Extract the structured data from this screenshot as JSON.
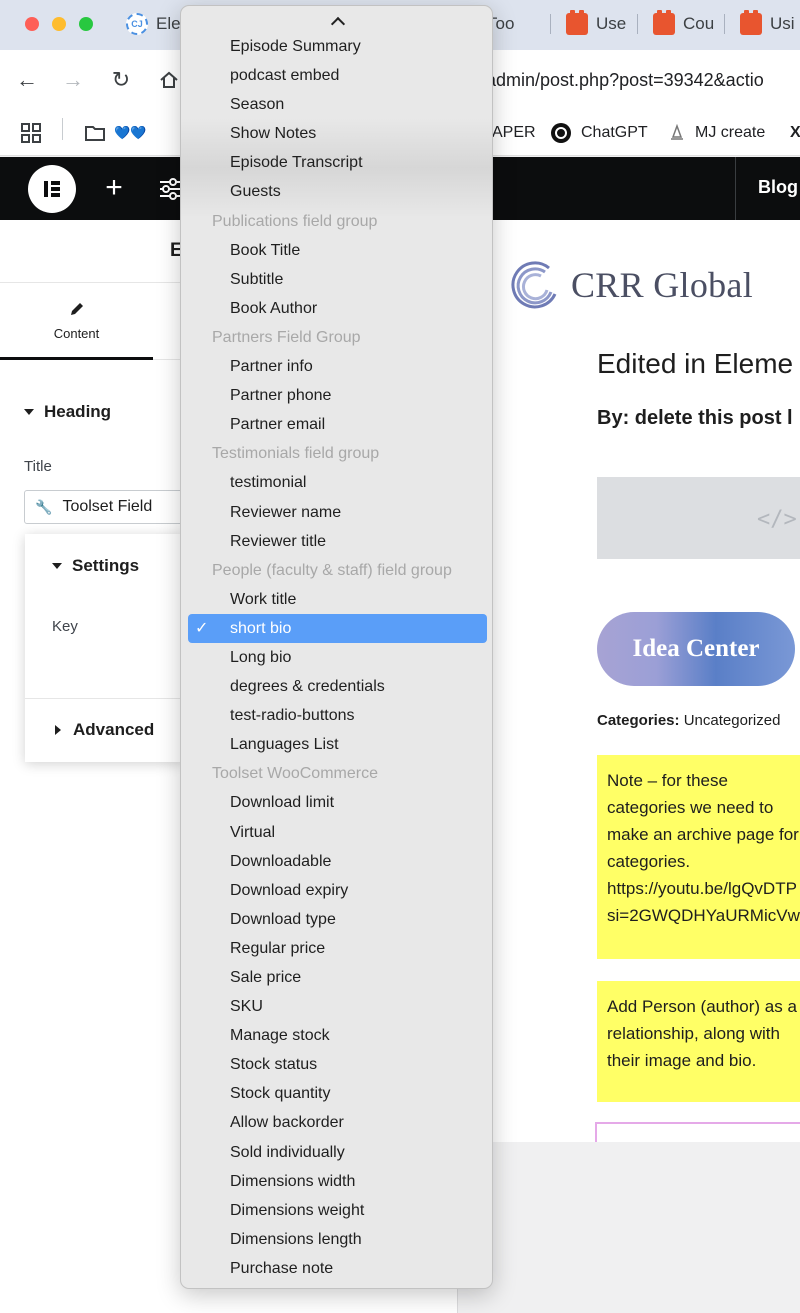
{
  "browser": {
    "tabs": [
      {
        "label": "Ele",
        "favicon": "circle-logo-icon"
      },
      {
        "label": "Too",
        "favicon": "brick-icon"
      },
      {
        "label": "Use",
        "favicon": "brick-icon"
      },
      {
        "label": "Cou",
        "favicon": "brick-icon"
      },
      {
        "label": "Usi",
        "favicon": "brick-icon"
      }
    ],
    "url": "-admin/post.php?post=39342&actio",
    "bookmarks": {
      "folder_label": "💙💙",
      "paper_label": "APER",
      "chatgpt_label": "ChatGPT",
      "mj_label": "MJ create"
    }
  },
  "elementor": {
    "topbar": {
      "blog_label": "Blog"
    },
    "panel": {
      "header_letter": "E",
      "tab_content_label": "Content",
      "section_heading": "Heading",
      "title_label": "Title",
      "title_value": "Toolset Field"
    },
    "settings_popup": {
      "settings_label": "Settings",
      "key_label": "Key",
      "advanced_label": "Advanced"
    }
  },
  "preview": {
    "logo_text": "CRR Global",
    "heading": "Edited in Eleme",
    "by_line": "By: delete this post l",
    "embed_icon": "</>",
    "idea_button": "Idea Center",
    "categories_label": "Categories:",
    "categories_value": "Uncategorized",
    "note1": "Note – for these\ncategories we need to\nmake an archive page for\ncategories.\nhttps://youtu.be/lgQvDTP\nsi=2GWQDHYaURMicVw",
    "note2": "Add Person (author) as a\nrelationship, along with\ntheir image and bio.",
    "colors": {
      "note_bg": "#ffff66",
      "brand_text": "#4b4f63"
    }
  },
  "dropdown": {
    "selected_value": "short bio",
    "selected_color": "#5a9ef8",
    "rows": [
      {
        "type": "option",
        "label": "Episode Summary"
      },
      {
        "type": "option",
        "label": "podcast embed"
      },
      {
        "type": "option",
        "label": "Season"
      },
      {
        "type": "option",
        "label": "Show Notes"
      },
      {
        "type": "option",
        "label": "Episode Transcript"
      },
      {
        "type": "option",
        "label": "Guests"
      },
      {
        "type": "group",
        "label": "Publications field group"
      },
      {
        "type": "option",
        "label": "Book Title"
      },
      {
        "type": "option",
        "label": "Subtitle"
      },
      {
        "type": "option",
        "label": "Book Author"
      },
      {
        "type": "group",
        "label": "Partners Field Group"
      },
      {
        "type": "option",
        "label": "Partner info"
      },
      {
        "type": "option",
        "label": "Partner phone"
      },
      {
        "type": "option",
        "label": "Partner email"
      },
      {
        "type": "group",
        "label": "Testimonials field group"
      },
      {
        "type": "option",
        "label": "testimonial"
      },
      {
        "type": "option",
        "label": "Reviewer name"
      },
      {
        "type": "option",
        "label": "Reviewer title"
      },
      {
        "type": "group",
        "label": "People (faculty & staff) field group"
      },
      {
        "type": "option",
        "label": "Work title"
      },
      {
        "type": "selected",
        "label": "short bio"
      },
      {
        "type": "option",
        "label": "Long bio"
      },
      {
        "type": "option",
        "label": "degrees & credentials"
      },
      {
        "type": "option",
        "label": "test-radio-buttons"
      },
      {
        "type": "option",
        "label": "Languages List"
      },
      {
        "type": "group",
        "label": "Toolset WooCommerce"
      },
      {
        "type": "option",
        "label": "Download limit"
      },
      {
        "type": "option",
        "label": "Virtual"
      },
      {
        "type": "option",
        "label": "Downloadable"
      },
      {
        "type": "option",
        "label": "Download expiry"
      },
      {
        "type": "option",
        "label": "Download type"
      },
      {
        "type": "option",
        "label": "Regular price"
      },
      {
        "type": "option",
        "label": "Sale price"
      },
      {
        "type": "option",
        "label": "SKU"
      },
      {
        "type": "option",
        "label": "Manage stock"
      },
      {
        "type": "option",
        "label": "Stock status"
      },
      {
        "type": "option",
        "label": "Stock quantity"
      },
      {
        "type": "option",
        "label": "Allow backorder"
      },
      {
        "type": "option",
        "label": "Sold individually"
      },
      {
        "type": "option",
        "label": "Dimensions width"
      },
      {
        "type": "option",
        "label": "Dimensions weight"
      },
      {
        "type": "option",
        "label": "Dimensions length"
      },
      {
        "type": "option",
        "label": "Purchase note"
      }
    ]
  }
}
